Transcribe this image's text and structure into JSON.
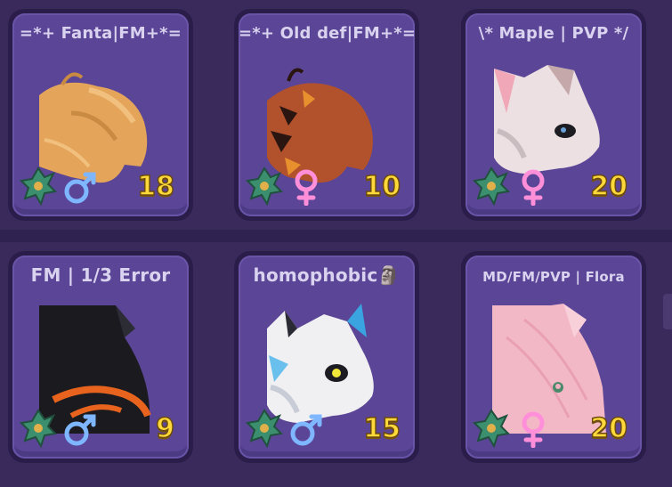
{
  "cards": [
    {
      "name": "=*+ Fanta|FM+*=",
      "gender": "male",
      "gender_symbol": "♂",
      "level": "18",
      "body_color": "#e4a45a"
    },
    {
      "name": "=*+ Old def|FM+*=",
      "gender": "female",
      "gender_symbol": "♀",
      "level": "10",
      "body_color": "#b2522c"
    },
    {
      "name": "\\* Maple | PVP */",
      "gender": "female",
      "gender_symbol": "♀",
      "level": "20",
      "body_color": "#ece0e2"
    },
    {
      "name": "FM | 1/3 Error",
      "gender": "male",
      "gender_symbol": "♂",
      "level": "9",
      "body_color": "#1b1b1f"
    },
    {
      "name": "homophobic🗿",
      "gender": "male",
      "gender_symbol": "♂",
      "level": "15",
      "body_color": "#f0f0f2"
    },
    {
      "name": "MD/FM/PVP | Flora",
      "gender": "female",
      "gender_symbol": "♀",
      "level": "20",
      "body_color": "#f3b8c6"
    }
  ],
  "colors": {
    "background": "#3a2a5c",
    "card": "#5b4596",
    "level_text": "#ffd83a",
    "male": "#7eb6ff",
    "female": "#ff8fd8"
  }
}
